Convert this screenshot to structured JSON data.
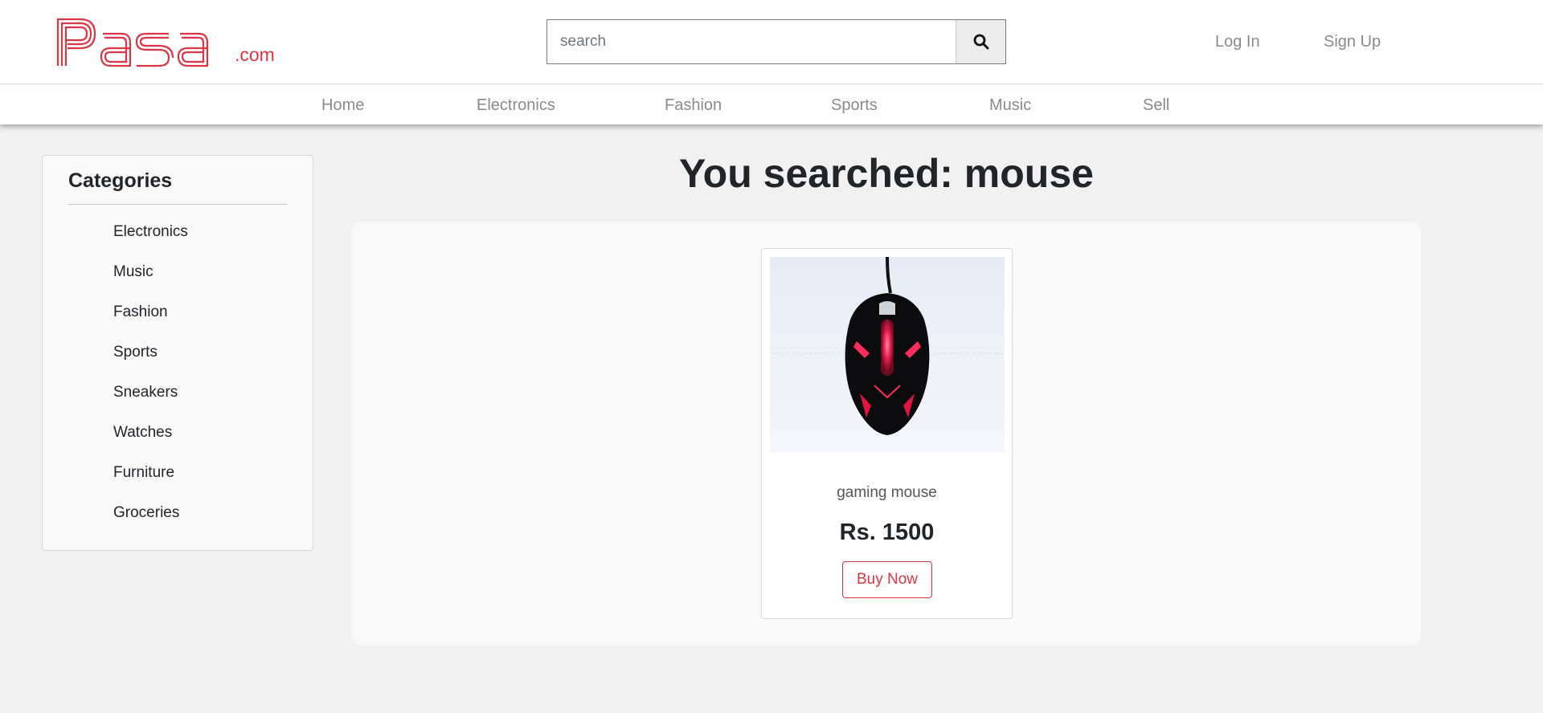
{
  "header": {
    "logo_text": "Pasa",
    "logo_suffix": ".com",
    "search_placeholder": "search",
    "search_icon": "magnifier-icon",
    "login_label": "Log In",
    "signup_label": "Sign Up"
  },
  "nav": {
    "items": [
      {
        "label": "Home"
      },
      {
        "label": "Electronics"
      },
      {
        "label": "Fashion"
      },
      {
        "label": "Sports"
      },
      {
        "label": "Music"
      },
      {
        "label": "Sell"
      }
    ]
  },
  "sidebar": {
    "title": "Categories",
    "items": [
      {
        "label": "Electronics"
      },
      {
        "label": "Music"
      },
      {
        "label": "Fashion"
      },
      {
        "label": "Sports"
      },
      {
        "label": "Sneakers"
      },
      {
        "label": "Watches"
      },
      {
        "label": "Furniture"
      },
      {
        "label": "Groceries"
      }
    ]
  },
  "results": {
    "title": "You searched: mouse",
    "products": [
      {
        "name": "gaming mouse",
        "price": "Rs. 1500",
        "button_label": "Buy Now",
        "image": "gaming-mouse-image"
      }
    ]
  },
  "colors": {
    "brand": "#dc3545",
    "background": "#f1f1f1",
    "nav_text": "#8a8a8a"
  }
}
